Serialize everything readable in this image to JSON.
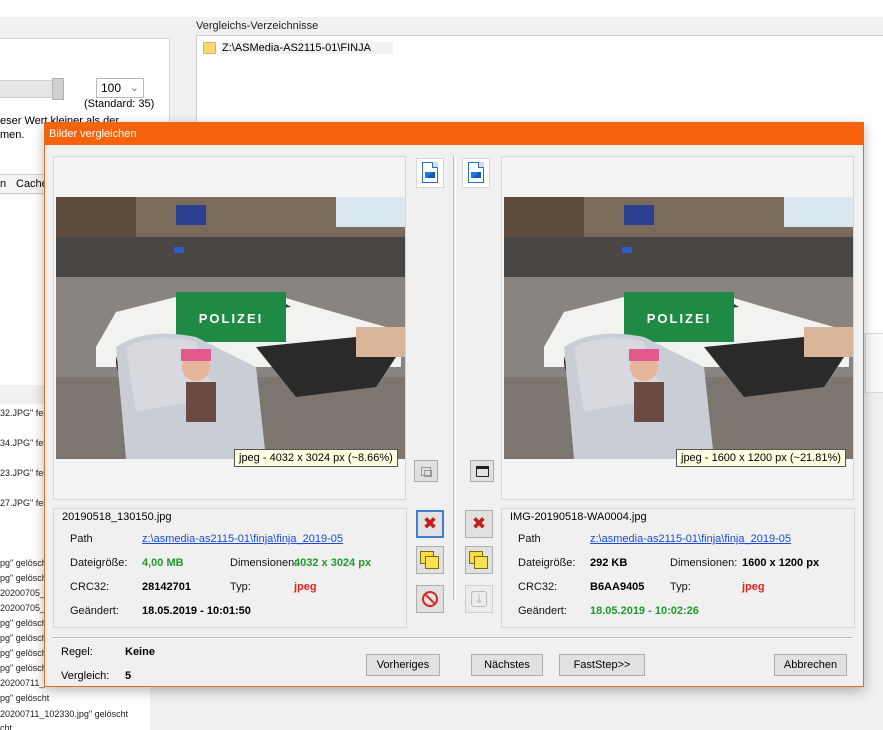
{
  "background": {
    "combo_value": "100",
    "standard_text": "(Standard: 35)",
    "hint_text": "eser Wert kleiner als der\nmen.",
    "tabs": [
      "n",
      "Cache"
    ],
    "folders_label": "Vergleichs-Verzeichnisse",
    "folder_path": "Z:\\ASMedia-AS2115-01\\FINJA",
    "log_lines": [
      "32.JPG\" feh",
      "34.JPG\" feh",
      "23.JPG\" feh",
      "27.JPG\" feh",
      "pg\" gelöscht",
      "pg\" gelöscht",
      "20200705_",
      "20200705_",
      "pg\" gelöscht",
      "pg\" gelöscht",
      "pg\" gelöscht",
      "pg\" gelöscht",
      "20200711_",
      "20200711_",
      "pg\" gelöscht",
      "20200711_102330.jpg\" gelöscht",
      "cht"
    ]
  },
  "dialog": {
    "title": "Bilder vergleichen",
    "left": {
      "resolution": "jpeg - 4032 x 3024 px (~8.66%)",
      "filename": "20190518_130150.jpg",
      "path_label": "Path",
      "path": "z:\\asmedia-as2115-01\\finja\\finja_2019-05",
      "size_label": "Dateigröße:",
      "size": "4,00 MB",
      "dims_label": "Dimensionen:",
      "dims": "4032 x 3024 px",
      "crc_label": "CRC32:",
      "crc": "28142701",
      "type_label": "Typ:",
      "type": "jpeg",
      "changed_label": "Geändert:",
      "changed": "18.05.2019 - 10:01:50"
    },
    "right": {
      "resolution": "jpeg - 1600 x 1200 px (~21.81%)",
      "filename": "IMG-20190518-WA0004.jpg",
      "path_label": "Path",
      "path": "z:\\asmedia-as2115-01\\finja\\finja_2019-05",
      "size_label": "Dateigröße:",
      "size": "292 KB",
      "dims_label": "Dimensionen:",
      "dims": "1600 x 1200 px",
      "crc_label": "CRC32:",
      "crc": "B6AA9405",
      "type_label": "Typ:",
      "type": "jpeg",
      "changed_label": "Geändert:",
      "changed": "18.05.2019 - 10:02:26"
    },
    "photo_text": "POLIZEI",
    "footer": {
      "rule_label": "Regel:",
      "rule_value": "Keine",
      "compare_label": "Vergleich:",
      "compare_value": "5"
    },
    "buttons": {
      "prev": "Vorheriges",
      "next": "Nächstes",
      "faststep": "FastStep>>",
      "cancel": "Abbrechen"
    }
  },
  "colors": {
    "titlebar": "#f7630c",
    "green_value": "#219a2b",
    "red_value": "#e0241d",
    "link": "#1a4bd6"
  }
}
